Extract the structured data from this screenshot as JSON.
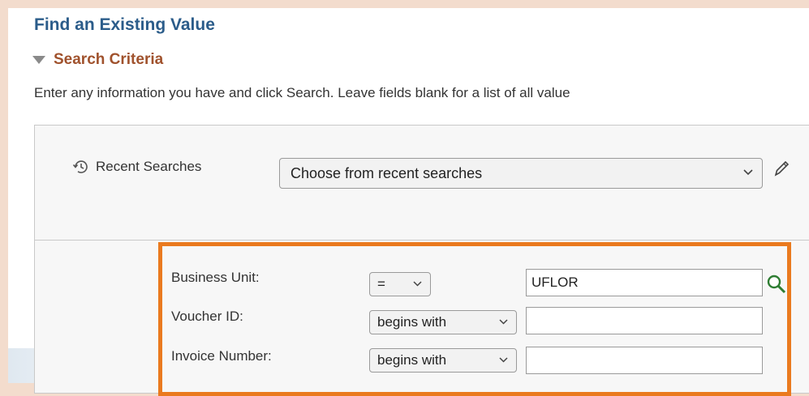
{
  "title": "Find an Existing Value",
  "section": {
    "label": "Search Criteria"
  },
  "instructions": "Enter any information you have and click Search. Leave fields blank for a list of all value",
  "recent": {
    "label": "Recent Searches",
    "placeholder": "Choose from recent searches"
  },
  "fields": [
    {
      "label": "Business Unit:",
      "operator": "=",
      "value": "UFLOR"
    },
    {
      "label": "Voucher ID:",
      "operator": "begins with",
      "value": ""
    },
    {
      "label": "Invoice Number:",
      "operator": "begins with",
      "value": ""
    }
  ],
  "colors": {
    "title": "#2b5c8a",
    "section": "#a0522d",
    "highlight": "#ea7a1f",
    "lookup": "#2e7d32"
  },
  "icons": [
    "triangle-down-icon",
    "history-icon",
    "chevron-down-icon",
    "pencil-icon",
    "search-icon"
  ]
}
